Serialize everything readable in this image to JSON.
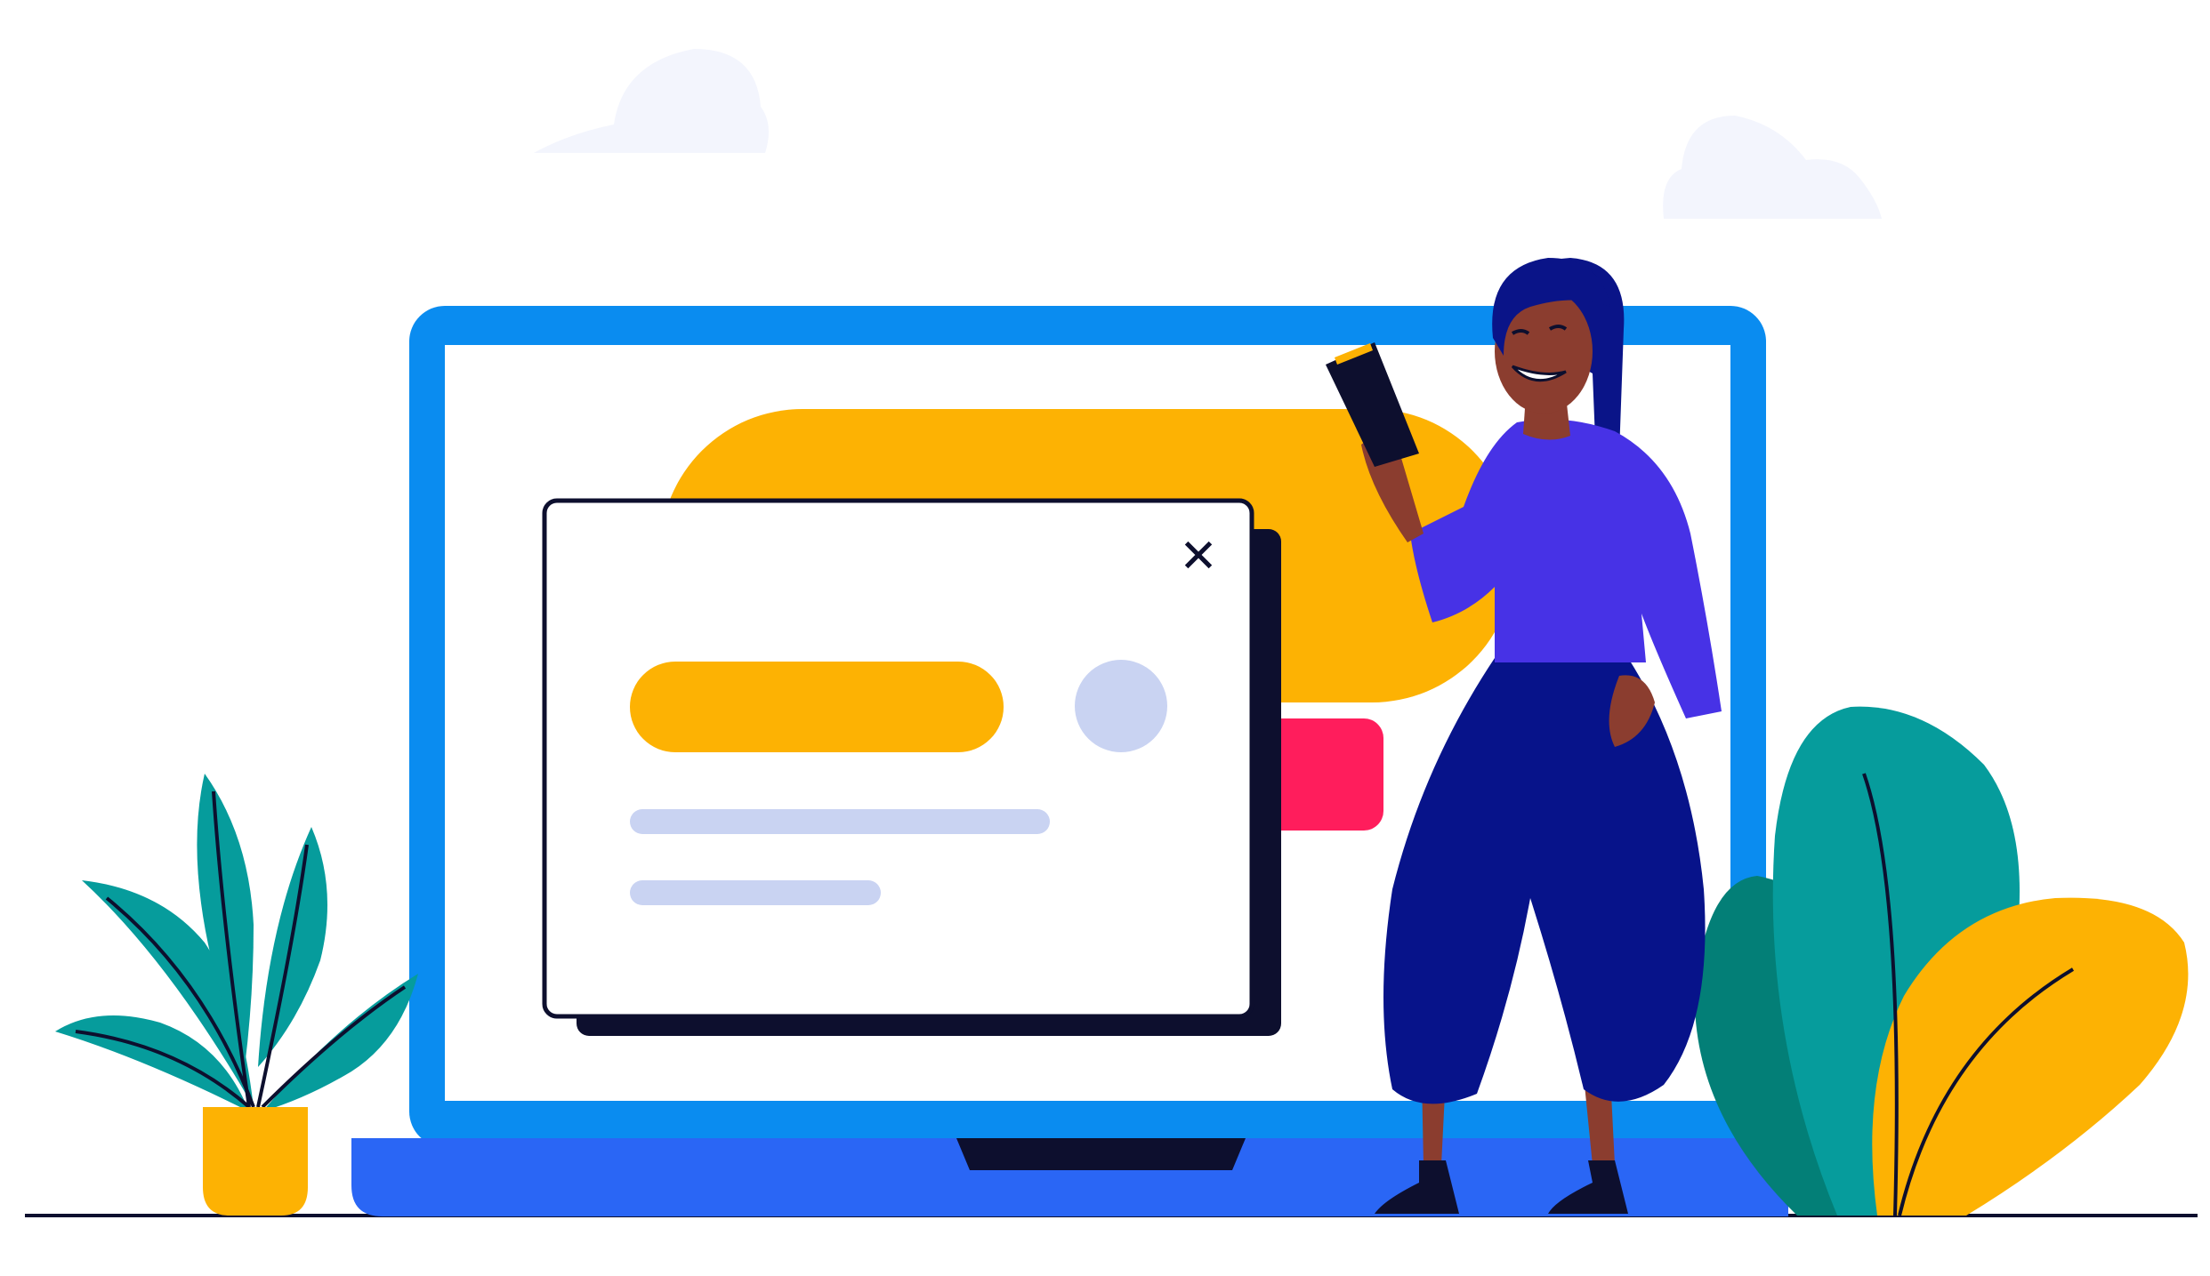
{
  "illustration": {
    "colors": {
      "laptop_frame": "#0a8cf0",
      "laptop_base": "#2a66f5",
      "screen": "#ffffff",
      "notch": "#0d0f2e",
      "accent_yellow": "#fdb203",
      "accent_red": "#ff1d5c",
      "placeholder_light": "#c9d3f2",
      "dialog_shadow": "#0d0f2e",
      "cloud": "#f3f5fd",
      "leaf_teal": "#069c9c",
      "leaf_dark_teal": "#037f77",
      "pot": "#fdb203",
      "shirt": "#4732e6",
      "pants": "#07138a",
      "hair": "#0a1488",
      "skin": "#8b3d2f",
      "book": "#0d0f2e",
      "ground_line": "#0d0f2e"
    },
    "icons": {
      "dialog_close": "close-icon",
      "avatar_placeholder": "avatar-placeholder-icon"
    },
    "dialog": {
      "close_glyph": "✕"
    }
  }
}
